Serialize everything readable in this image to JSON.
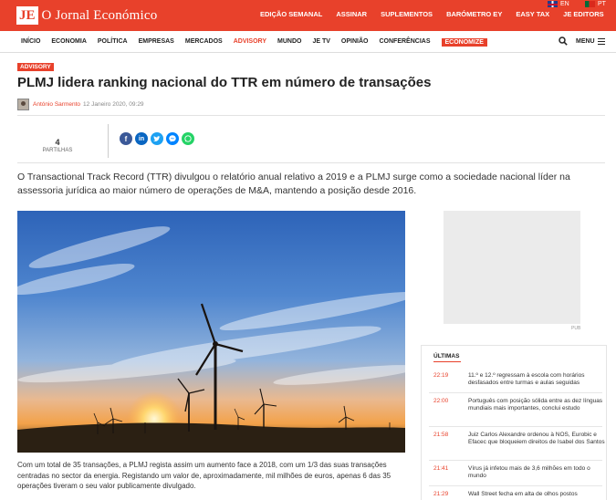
{
  "header": {
    "logo_mark": "JE",
    "logo_text": "O Jornal Económico",
    "top_links": [
      "EDIÇÃO SEMANAL",
      "ASSINAR",
      "SUPLEMENTOS",
      "BARÓMETRO EY",
      "EASY TAX",
      "JE EDITORS"
    ],
    "lang_en": "EN",
    "lang_pt": "PT"
  },
  "nav": {
    "items": [
      "INÍCIO",
      "ECONOMIA",
      "POLÍTICA",
      "EMPRESAS",
      "MERCADOS",
      "ADVISORY",
      "MUNDO",
      "JE TV",
      "OPINIÃO",
      "CONFERÊNCIAS",
      "ECONOMIZE"
    ],
    "active": "ADVISORY",
    "menu_label": "MENU"
  },
  "article": {
    "tag": "ADVISORY",
    "title": "PLMJ lidera ranking nacional do TTR em número de transações",
    "author": "António Sarmento",
    "date": "12 Janeiro 2020, 09:29",
    "shares_count": "4",
    "shares_label": "PARTILHAS",
    "social": [
      "facebook-icon",
      "linkedin-icon",
      "twitter-icon",
      "messenger-icon",
      "whatsapp-icon"
    ],
    "lead": "O Transactional Track Record (TTR) divulgou o relatório anual relativo a 2019 e a PLMJ surge como a sociedade nacional líder na assessoria jurídica ao maior número de operações de M&A, mantendo a posição desde 2016.",
    "body": "Com um total de 35 transações, a PLMJ regista assim um aumento face a 2018, com um 1/3 das suas transações centradas no sector da energia. Registando um valor de, aproximadamente, mil milhões de euros, apenas 6 das 35 operações tiveram o seu valor publicamente divulgado."
  },
  "sidebar": {
    "pub_label": "PUB",
    "ultimas_title": "ÚLTIMAS",
    "news": [
      {
        "time": "22:19",
        "text": "11.º e 12.º regressam à escola com horários desfasados entre turmas e aulas seguidas"
      },
      {
        "time": "22:00",
        "text": "Português com posição sólida entre as dez línguas mundiais mais importantes, conclui estudo"
      },
      {
        "time": "21:58",
        "text": "Juiz Carlos Alexandre ordenou à NOS, Eurobic e Efacec que bloqueiem direitos de Isabel dos Santos"
      },
      {
        "time": "21:41",
        "text": "Vírus já infetou mais de 3,6 milhões em todo o mundo"
      },
      {
        "time": "21:29",
        "text": "Wall Street fecha em alta de olhos postos"
      }
    ]
  },
  "colors": {
    "brand": "#e8412b"
  }
}
